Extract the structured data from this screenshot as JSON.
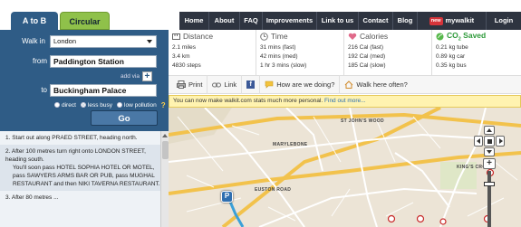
{
  "tabs": [
    {
      "label": "A to B",
      "active": true
    },
    {
      "label": "Circular",
      "active": false
    }
  ],
  "nav": {
    "items": [
      "Home",
      "About",
      "FAQ",
      "Improvements",
      "Link to us",
      "Contact",
      "Blog"
    ],
    "new_badge": "new",
    "mywalkit": "mywalkit",
    "login": "Login"
  },
  "form": {
    "walk_in_label": "Walk in",
    "city_value": "London",
    "from_label": "from",
    "from_value": "Paddington Station",
    "add_via": "add via",
    "add_via_plus": "+",
    "to_label": "to",
    "to_value": "Buckingham Palace",
    "options": [
      {
        "label": "direct",
        "selected": false
      },
      {
        "label": "less busy",
        "selected": true
      },
      {
        "label": "low pollution",
        "selected": false
      }
    ],
    "help": "?",
    "go_label": "Go"
  },
  "directions": [
    {
      "text": "1.  Start out along PRAED STREET, heading north.",
      "note": ""
    },
    {
      "text": "2.  After 100 metres turn right onto LONDON STREET, heading south.",
      "note": "You'll soon pass HOTEL SOPHIA HOTEL OR MOTEL, pass SAWYERS ARMS BAR OR PUB, pass MUGHAL RESTAURANT and then NIKI TAVERNA RESTAURANT."
    },
    {
      "text": "3.  After 80 metres ...",
      "note": ""
    }
  ],
  "stats": {
    "distance": {
      "title": "Distance",
      "lines": [
        "2.1 miles",
        "3.4 km",
        "4830 steps"
      ]
    },
    "time": {
      "title": "Time",
      "lines": [
        "31 mins (fast)",
        "42 mins (med)",
        "1 hr 3 mins (slow)"
      ]
    },
    "calories": {
      "title": "Calories",
      "lines": [
        "216 Cal (fast)",
        "192 Cal (med)",
        "185 Cal (slow)"
      ]
    },
    "co2": {
      "title": "CO",
      "title_sub": "2",
      "title_suffix": " Saved",
      "lines": [
        "0.21 kg tube",
        "0.89 kg car",
        "0.35 kg bus"
      ]
    }
  },
  "toolbar": {
    "print": "Print",
    "link": "Link",
    "facebook": "f",
    "how": "How are we doing?",
    "walk_here": "Walk here often?"
  },
  "banner": {
    "text": "You can now make walkit.com stats much more personal. ",
    "link": "Find out more..."
  },
  "map": {
    "labels": [
      "ST JOHN'S WOOD",
      "EUSTON ROAD",
      "MARYLEBONE",
      "KING'S CROSS"
    ],
    "marker": "P"
  },
  "colors": {
    "brand_blue": "#2f5c86",
    "nav_bg": "#2e3440",
    "tab_green": "#8fc14a",
    "co2_green": "#2e9a3a",
    "banner_bg": "#fff3b0",
    "route": "#3aa0d8"
  }
}
